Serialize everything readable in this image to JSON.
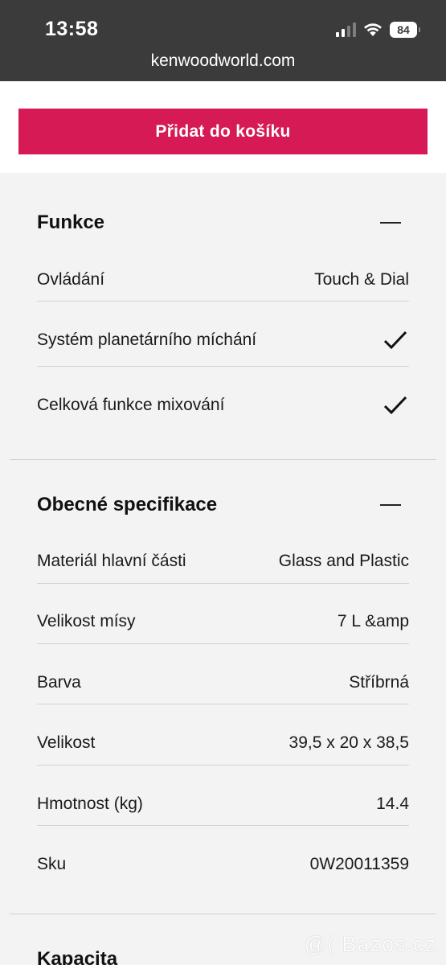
{
  "status": {
    "time": "13:58",
    "battery": "84"
  },
  "browser": {
    "url": "kenwoodworld.com"
  },
  "cart": {
    "button_label": "Přidat do košíku"
  },
  "sections": [
    {
      "title": "Funkce",
      "rows": [
        {
          "label": "Ovládání",
          "value": "Touch & Dial"
        },
        {
          "label": "Systém planetárního míchání",
          "value": "check"
        },
        {
          "label": "Celková funkce mixování",
          "value": "check"
        }
      ]
    },
    {
      "title": "Obecné specifikace",
      "rows": [
        {
          "label": "Materiál hlavní části",
          "value": "Glass and Plastic"
        },
        {
          "label": "Velikost mísy",
          "value": "7 L &amp"
        },
        {
          "label": "Barva",
          "value": "Stříbrná"
        },
        {
          "label": "Velikost",
          "value": "39,5 x 20 x 38,5"
        },
        {
          "label": "Hmotnost (kg)",
          "value": "14.4"
        },
        {
          "label": "Sku",
          "value": "0W20011359"
        }
      ]
    },
    {
      "title": "Kapacita"
    }
  ],
  "watermark": "@( Bazos.cz"
}
